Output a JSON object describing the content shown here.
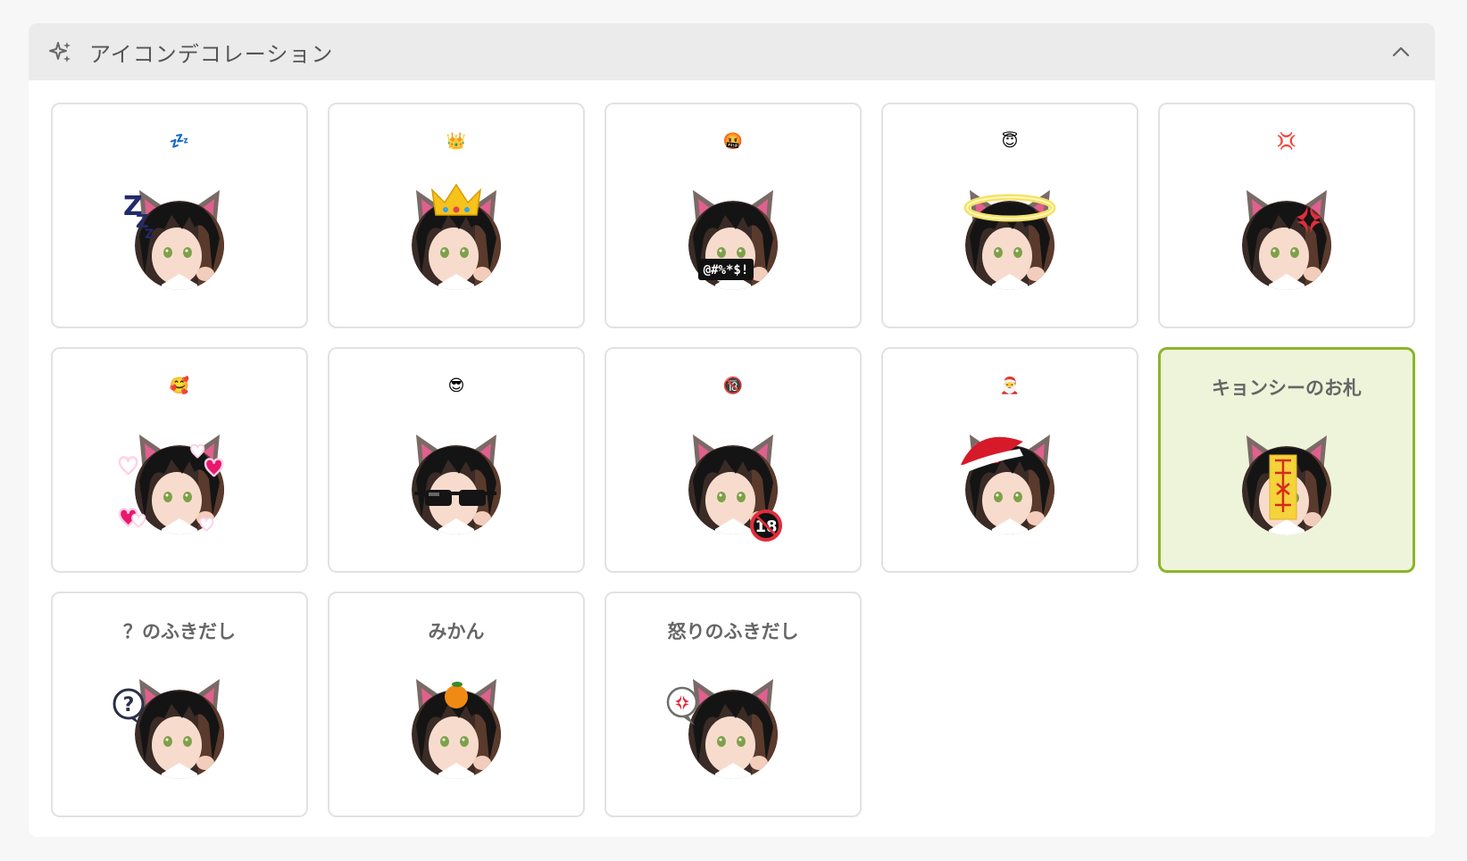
{
  "header": {
    "title": "アイコンデコレーション",
    "icon": "sparkle-icon",
    "collapse_icon": "chevron-up-icon"
  },
  "colors": {
    "selected_border": "#8bb52a",
    "selected_background": "#eef4da",
    "header_background": "#ebebeb"
  },
  "decorations": [
    {
      "id": "sleep",
      "emoji": "💤",
      "label": null,
      "selected": false,
      "overlay": "zzz"
    },
    {
      "id": "crown",
      "emoji": "👑",
      "label": null,
      "selected": false,
      "overlay": "crown"
    },
    {
      "id": "cursing",
      "emoji": "🤬",
      "label": null,
      "selected": false,
      "overlay": "censor"
    },
    {
      "id": "angel",
      "emoji": "😇",
      "label": null,
      "selected": false,
      "overlay": "halo"
    },
    {
      "id": "anger-mark",
      "emoji": "💢",
      "label": null,
      "selected": false,
      "overlay": "anger"
    },
    {
      "id": "hearts",
      "emoji": "🥰",
      "label": null,
      "selected": false,
      "overlay": "hearts"
    },
    {
      "id": "sunglasses",
      "emoji": "😎",
      "label": null,
      "selected": false,
      "overlay": "sunglasses"
    },
    {
      "id": "r18",
      "emoji": "🔞",
      "label": null,
      "selected": false,
      "overlay": "r18"
    },
    {
      "id": "santa",
      "emoji": "🎅",
      "label": null,
      "selected": false,
      "overlay": "santa"
    },
    {
      "id": "jiangshi",
      "emoji": null,
      "label": "キョンシーのお札",
      "selected": true,
      "overlay": "talisman"
    },
    {
      "id": "question-bubble",
      "emoji": null,
      "label": "？のふきだし",
      "selected": false,
      "overlay": "question"
    },
    {
      "id": "mikan",
      "emoji": null,
      "label": "みかん",
      "selected": false,
      "overlay": "mikan"
    },
    {
      "id": "anger-bubble",
      "emoji": null,
      "label": "怒りのふきだし",
      "selected": false,
      "overlay": "angerbubble"
    }
  ],
  "overlay_text": {
    "censor": "@#%*$!",
    "r18": "18",
    "question": "?",
    "zzz": "Z"
  }
}
